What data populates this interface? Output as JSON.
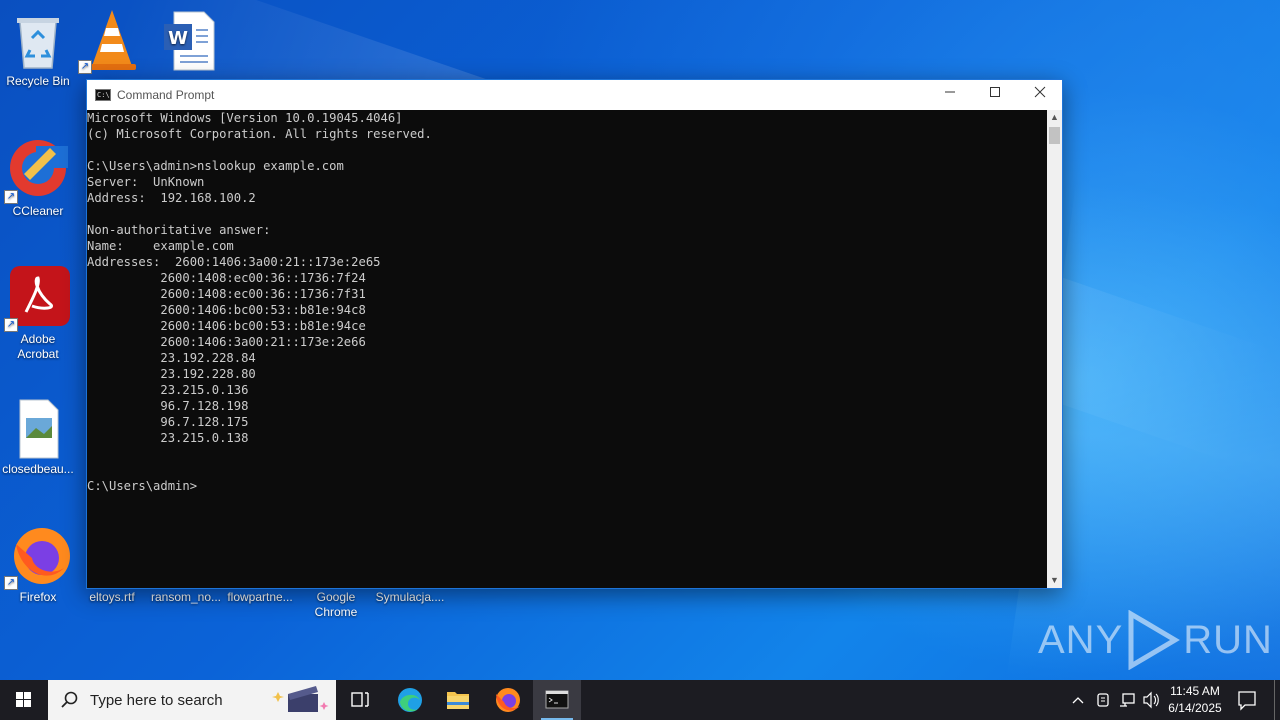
{
  "desktop": {
    "icons": {
      "recycle_bin": "Recycle Bin",
      "ccleaner": "CCleaner",
      "adobe_acrobat": "Adobe\nAcrobat",
      "closedbeau": "closedbeau...",
      "firefox": "Firefox",
      "eltoys": "eltoys.rtf",
      "ransom": "ransom_no...",
      "flowpartne": "flowpartne...",
      "google_chrome": "Google\nChrome",
      "symulacja": "Symulacja...."
    }
  },
  "cmd": {
    "title": "Command Prompt",
    "lines": [
      "Microsoft Windows [Version 10.0.19045.4046]",
      "(c) Microsoft Corporation. All rights reserved.",
      "",
      "C:\\Users\\admin>nslookup example.com",
      "Server:  UnKnown",
      "Address:  192.168.100.2",
      "",
      "Non-authoritative answer:",
      "Name:    example.com",
      "Addresses:  2600:1406:3a00:21::173e:2e65",
      "          2600:1408:ec00:36::1736:7f24",
      "          2600:1408:ec00:36::1736:7f31",
      "          2600:1406:bc00:53::b81e:94c8",
      "          2600:1406:bc00:53::b81e:94ce",
      "          2600:1406:3a00:21::173e:2e66",
      "          23.192.228.84",
      "          23.192.228.80",
      "          23.215.0.136",
      "          96.7.128.198",
      "          96.7.128.175",
      "          23.215.0.138",
      "",
      "",
      "C:\\Users\\admin>"
    ]
  },
  "watermark": {
    "left": "ANY",
    "right": "RUN"
  },
  "taskbar": {
    "search_placeholder": "Type here to search",
    "clock_time": "11:45 AM",
    "clock_date": "6/14/2025"
  }
}
